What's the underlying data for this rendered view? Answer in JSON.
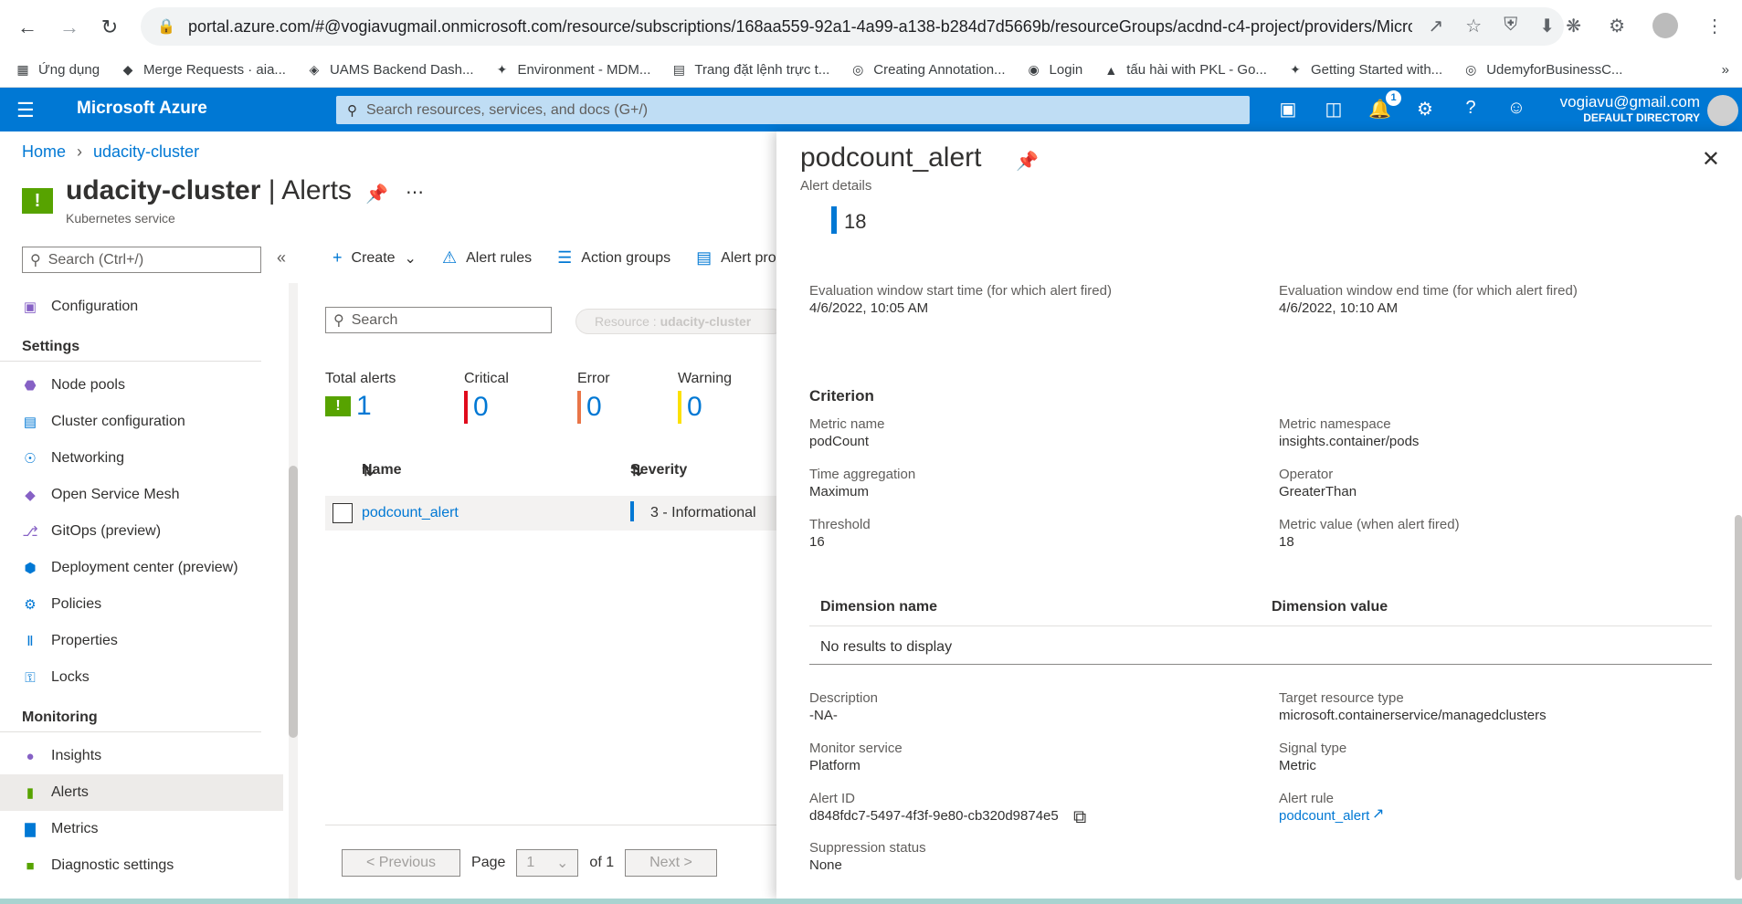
{
  "browser": {
    "url": "portal.azure.com/#@vogiavugmail.onmicrosoft.com/resource/subscriptions/168aa559-92a1-4a99-a138-b284d7d5669b/resourceGroups/acdnd-c4-project/providers/Micro...",
    "bookmarks": [
      {
        "icon": "apps-icon",
        "label": "Ứng dụng"
      },
      {
        "icon": "gitlab-icon",
        "label": "Merge Requests · aia..."
      },
      {
        "icon": "diamond-icon",
        "label": "UAMS Backend Dash..."
      },
      {
        "icon": "fpt-icon",
        "label": "Environment - MDM..."
      },
      {
        "icon": "doc-icon",
        "label": "Trang đặt lệnh trực t..."
      },
      {
        "icon": "globe-icon",
        "label": "Creating Annotation..."
      },
      {
        "icon": "login-icon",
        "label": "Login"
      },
      {
        "icon": "drive-icon",
        "label": "tấu hài with PKL - Go..."
      },
      {
        "icon": "fpt-icon",
        "label": "Getting Started with..."
      },
      {
        "icon": "globe-icon",
        "label": "UdemyforBusinessC..."
      }
    ]
  },
  "azure": {
    "brand": "Microsoft Azure",
    "search_placeholder": "Search resources, services, and docs (G+/)",
    "notification_count": "1",
    "account_email": "vogiavu@gmail.com",
    "account_directory": "DEFAULT DIRECTORY"
  },
  "breadcrumb": [
    "Home",
    "udacity-cluster"
  ],
  "resource": {
    "name": "udacity-cluster",
    "page": "Alerts",
    "separator": " | ",
    "type": "Kubernetes service"
  },
  "sidebar": {
    "search_placeholder": "Search (Ctrl+/)",
    "items": [
      {
        "type": "item",
        "icon": "configuration-icon",
        "label": "Configuration"
      },
      {
        "type": "section",
        "label": "Settings"
      },
      {
        "type": "item",
        "icon": "node-pools-icon",
        "label": "Node pools"
      },
      {
        "type": "item",
        "icon": "cluster-config-icon",
        "label": "Cluster configuration"
      },
      {
        "type": "item",
        "icon": "networking-icon",
        "label": "Networking"
      },
      {
        "type": "item",
        "icon": "service-mesh-icon",
        "label": "Open Service Mesh"
      },
      {
        "type": "item",
        "icon": "gitops-icon",
        "label": "GitOps (preview)"
      },
      {
        "type": "item",
        "icon": "deployment-center-icon",
        "label": "Deployment center (preview)"
      },
      {
        "type": "item",
        "icon": "policies-icon",
        "label": "Policies"
      },
      {
        "type": "item",
        "icon": "properties-icon",
        "label": "Properties"
      },
      {
        "type": "item",
        "icon": "lock-icon",
        "label": "Locks"
      },
      {
        "type": "section",
        "label": "Monitoring"
      },
      {
        "type": "item",
        "icon": "insights-icon",
        "label": "Insights"
      },
      {
        "type": "item",
        "icon": "alerts-icon",
        "label": "Alerts",
        "active": true
      },
      {
        "type": "item",
        "icon": "metrics-icon",
        "label": "Metrics"
      },
      {
        "type": "item",
        "icon": "diagnostic-settings-icon",
        "label": "Diagnostic settings"
      }
    ]
  },
  "toolbar": {
    "create": "Create",
    "alert_rules": "Alert rules",
    "action_groups": "Action groups",
    "alert_processing": "Alert pro"
  },
  "content": {
    "search_placeholder": "Search",
    "filter_label": "Resource : ",
    "filter_value": "udacity-cluster",
    "stats": [
      {
        "label": "Total alerts",
        "value": "1",
        "color": "#57a300"
      },
      {
        "label": "Critical",
        "value": "0",
        "color": "#e00b1c"
      },
      {
        "label": "Error",
        "value": "0",
        "color": "#e97548"
      },
      {
        "label": "Warning",
        "value": "0",
        "color": "#fce100"
      }
    ],
    "columns": {
      "name": "Name",
      "severity": "Severity"
    },
    "row": {
      "name": "podcount_alert",
      "severity": "3 - Informational"
    },
    "pager": {
      "previous": "< Previous",
      "page_label": "Page",
      "page_value": "1",
      "of_label": "of 1",
      "next": "Next >"
    }
  },
  "panel": {
    "title": "podcount_alert",
    "subtitle": "Alert details",
    "metric_value": "18",
    "eval_start_label": "Evaluation window start time (for which alert fired)",
    "eval_start_value": "4/6/2022, 10:05 AM",
    "eval_end_label": "Evaluation window end time (for which alert fired)",
    "eval_end_value": "4/6/2022, 10:10 AM",
    "criterion_heading": "Criterion",
    "metric_name_label": "Metric name",
    "metric_name_value": "podCount",
    "metric_namespace_label": "Metric namespace",
    "metric_namespace_value": "insights.container/pods",
    "time_agg_label": "Time aggregation",
    "time_agg_value": "Maximum",
    "operator_label": "Operator",
    "operator_value": "GreaterThan",
    "threshold_label": "Threshold",
    "threshold_value": "16",
    "metric_value_label": "Metric value (when alert fired)",
    "metric_value_value": "18",
    "dim_name_header": "Dimension name",
    "dim_value_header": "Dimension value",
    "dim_empty": "No results to display",
    "description_label": "Description",
    "description_value": "-NA-",
    "target_type_label": "Target resource type",
    "target_type_value": "microsoft.containerservice/managedclusters",
    "monitor_service_label": "Monitor service",
    "monitor_service_value": "Platform",
    "signal_type_label": "Signal type",
    "signal_type_value": "Metric",
    "alert_id_label": "Alert ID",
    "alert_id_value": "d848fdc7-5497-4f3f-9e80-cb320d9874e5",
    "alert_rule_label": "Alert rule",
    "alert_rule_value": "podcount_alert",
    "suppression_label": "Suppression status",
    "suppression_value": "None"
  }
}
